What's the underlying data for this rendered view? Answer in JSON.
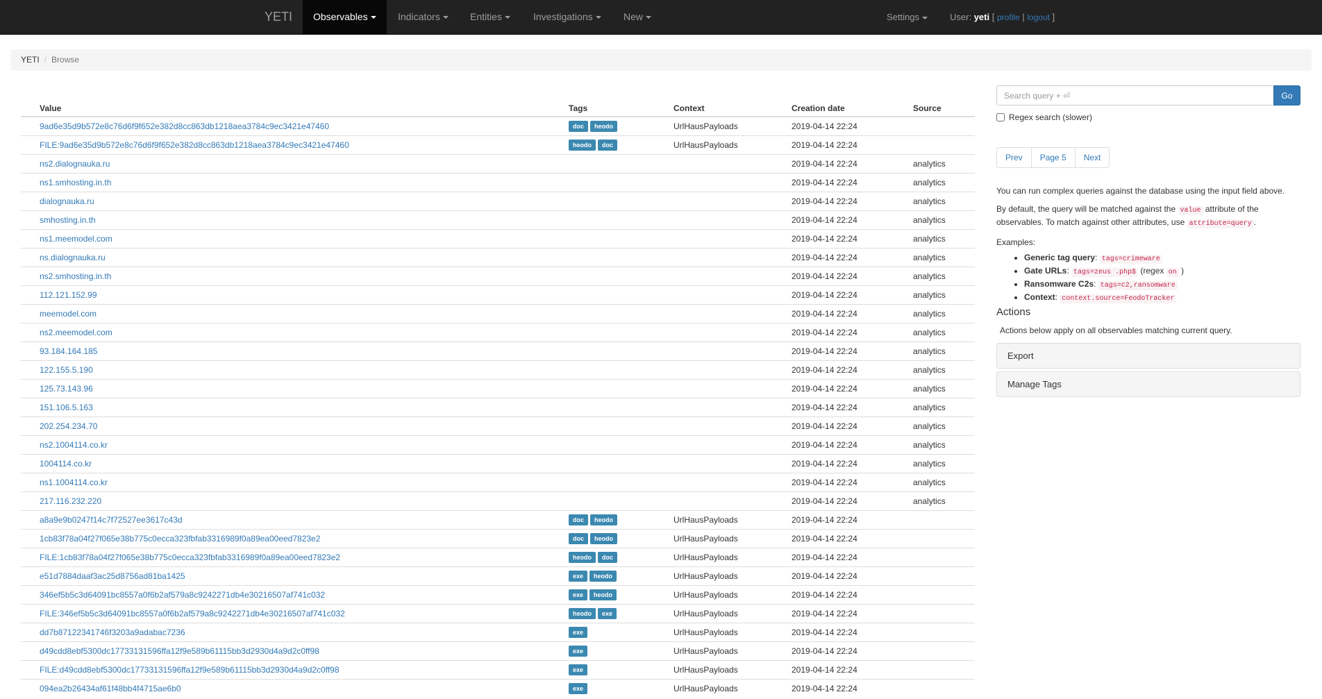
{
  "nav": {
    "brand": "YETI",
    "items": [
      {
        "label": "Observables",
        "active": true
      },
      {
        "label": "Indicators"
      },
      {
        "label": "Entities"
      },
      {
        "label": "Investigations"
      },
      {
        "label": "New"
      }
    ],
    "settings": "Settings",
    "user_prefix": "User:",
    "user_name": "yeti",
    "profile": "profile",
    "logout": "logout"
  },
  "breadcrumb": [
    "YETI",
    "Browse"
  ],
  "table": {
    "headers": [
      "Value",
      "Tags",
      "Context",
      "Creation date",
      "Source"
    ],
    "rows": [
      {
        "value": "9ad6e35d9b572e8c76d6f9f652e382d8cc863db1218aea3784c9ec3421e47460",
        "tags": [
          "doc",
          "heodo"
        ],
        "context": "UrlHausPayloads",
        "date": "2019-04-14 22:24",
        "source": ""
      },
      {
        "value": "FILE:9ad6e35d9b572e8c76d6f9f652e382d8cc863db1218aea3784c9ec3421e47460",
        "tags": [
          "heodo",
          "doc"
        ],
        "context": "UrlHausPayloads",
        "date": "2019-04-14 22:24",
        "source": ""
      },
      {
        "value": "ns2.dialognauka.ru",
        "tags": [],
        "context": "",
        "date": "2019-04-14 22:24",
        "source": "analytics"
      },
      {
        "value": "ns1.smhosting.in.th",
        "tags": [],
        "context": "",
        "date": "2019-04-14 22:24",
        "source": "analytics"
      },
      {
        "value": "dialognauka.ru",
        "tags": [],
        "context": "",
        "date": "2019-04-14 22:24",
        "source": "analytics"
      },
      {
        "value": "smhosting.in.th",
        "tags": [],
        "context": "",
        "date": "2019-04-14 22:24",
        "source": "analytics"
      },
      {
        "value": "ns1.meemodel.com",
        "tags": [],
        "context": "",
        "date": "2019-04-14 22:24",
        "source": "analytics"
      },
      {
        "value": "ns.dialognauka.ru",
        "tags": [],
        "context": "",
        "date": "2019-04-14 22:24",
        "source": "analytics"
      },
      {
        "value": "ns2.smhosting.in.th",
        "tags": [],
        "context": "",
        "date": "2019-04-14 22:24",
        "source": "analytics"
      },
      {
        "value": "112.121.152.99",
        "tags": [],
        "context": "",
        "date": "2019-04-14 22:24",
        "source": "analytics"
      },
      {
        "value": "meemodel.com",
        "tags": [],
        "context": "",
        "date": "2019-04-14 22:24",
        "source": "analytics"
      },
      {
        "value": "ns2.meemodel.com",
        "tags": [],
        "context": "",
        "date": "2019-04-14 22:24",
        "source": "analytics"
      },
      {
        "value": "93.184.164.185",
        "tags": [],
        "context": "",
        "date": "2019-04-14 22:24",
        "source": "analytics"
      },
      {
        "value": "122.155.5.190",
        "tags": [],
        "context": "",
        "date": "2019-04-14 22:24",
        "source": "analytics"
      },
      {
        "value": "125.73.143.96",
        "tags": [],
        "context": "",
        "date": "2019-04-14 22:24",
        "source": "analytics"
      },
      {
        "value": "151.106.5.163",
        "tags": [],
        "context": "",
        "date": "2019-04-14 22:24",
        "source": "analytics"
      },
      {
        "value": "202.254.234.70",
        "tags": [],
        "context": "",
        "date": "2019-04-14 22:24",
        "source": "analytics"
      },
      {
        "value": "ns2.1004114.co.kr",
        "tags": [],
        "context": "",
        "date": "2019-04-14 22:24",
        "source": "analytics"
      },
      {
        "value": "1004114.co.kr",
        "tags": [],
        "context": "",
        "date": "2019-04-14 22:24",
        "source": "analytics"
      },
      {
        "value": "ns1.1004114.co.kr",
        "tags": [],
        "context": "",
        "date": "2019-04-14 22:24",
        "source": "analytics"
      },
      {
        "value": "217.116.232.220",
        "tags": [],
        "context": "",
        "date": "2019-04-14 22:24",
        "source": "analytics"
      },
      {
        "value": "a8a9e9b0247f14c7f72527ee3617c43d",
        "tags": [
          "doc",
          "heodo"
        ],
        "context": "UrlHausPayloads",
        "date": "2019-04-14 22:24",
        "source": ""
      },
      {
        "value": "1cb83f78a04f27f065e38b775c0ecca323fbfab3316989f0a89ea00eed7823e2",
        "tags": [
          "doc",
          "heodo"
        ],
        "context": "UrlHausPayloads",
        "date": "2019-04-14 22:24",
        "source": ""
      },
      {
        "value": "FILE:1cb83f78a04f27f065e38b775c0ecca323fbfab3316989f0a89ea00eed7823e2",
        "tags": [
          "heodo",
          "doc"
        ],
        "context": "UrlHausPayloads",
        "date": "2019-04-14 22:24",
        "source": ""
      },
      {
        "value": "e51d7884daaf3ac25d8756ad81ba1425",
        "tags": [
          "exe",
          "heodo"
        ],
        "context": "UrlHausPayloads",
        "date": "2019-04-14 22:24",
        "source": ""
      },
      {
        "value": "346ef5b5c3d64091bc8557a0f6b2af579a8c9242271db4e30216507af741c032",
        "tags": [
          "exe",
          "heodo"
        ],
        "context": "UrlHausPayloads",
        "date": "2019-04-14 22:24",
        "source": ""
      },
      {
        "value": "FILE:346ef5b5c3d64091bc8557a0f6b2af579a8c9242271db4e30216507af741c032",
        "tags": [
          "heodo",
          "exe"
        ],
        "context": "UrlHausPayloads",
        "date": "2019-04-14 22:24",
        "source": ""
      },
      {
        "value": "dd7b87122341746f3203a9adabac7236",
        "tags": [
          "exe"
        ],
        "context": "UrlHausPayloads",
        "date": "2019-04-14 22:24",
        "source": ""
      },
      {
        "value": "d49cdd8ebf5300dc17733131596ffa12f9e589b61115bb3d2930d4a9d2c0ff98",
        "tags": [
          "exe"
        ],
        "context": "UrlHausPayloads",
        "date": "2019-04-14 22:24",
        "source": ""
      },
      {
        "value": "FILE:d49cdd8ebf5300dc17733131596ffa12f9e589b61115bb3d2930d4a9d2c0ff98",
        "tags": [
          "exe"
        ],
        "context": "UrlHausPayloads",
        "date": "2019-04-14 22:24",
        "source": ""
      },
      {
        "value": "094ea2b26434af61f48bb4f4715ae6b0",
        "tags": [
          "exe"
        ],
        "context": "UrlHausPayloads",
        "date": "2019-04-14 22:24",
        "source": ""
      }
    ]
  },
  "search": {
    "placeholder": "Search query + ⏎",
    "go": "Go",
    "regex_label": "Regex search (slower)"
  },
  "pager": {
    "prev": "Prev",
    "page": "Page 5",
    "next": "Next"
  },
  "help": {
    "p1": "You can run complex queries against the database using the input field above.",
    "p2_a": "By default, the query will be matched against the",
    "p2_code1": "value",
    "p2_b": "attribute of the observables. To match against other attributes, use",
    "p2_code2": "attribute=query",
    "p2_c": ".",
    "examples_label": "Examples:",
    "examples": [
      {
        "label": "Generic tag query",
        "code": "tags=crimeware",
        "suffix": ""
      },
      {
        "label": "Gate URLs",
        "code": "tags=zeus .php$",
        "suffix_a": " (regex ",
        "code2": "on",
        "suffix_b": " )"
      },
      {
        "label": "Ransomware C2s",
        "code": "tags=c2,ransomware",
        "suffix": ""
      },
      {
        "label": "Context",
        "code": "context.source=FeodoTracker",
        "suffix": ""
      }
    ]
  },
  "actions": {
    "title": "Actions",
    "desc": "Actions below apply on all observables matching current query.",
    "export": "Export",
    "manage_tags": "Manage Tags"
  }
}
